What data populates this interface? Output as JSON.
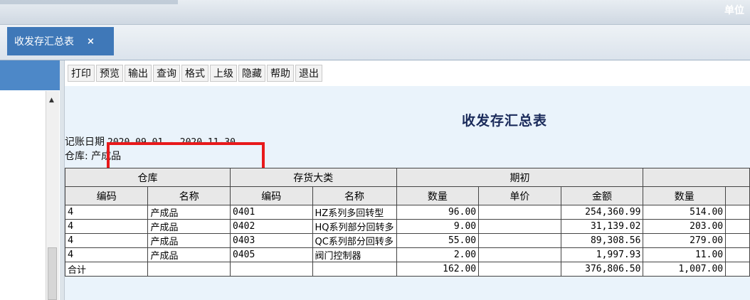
{
  "header": {
    "right_text": "单位"
  },
  "tab": {
    "label": "收发存汇总表",
    "close": "×"
  },
  "toolbar": {
    "buttons": [
      "打印",
      "预览",
      "输出",
      "查询",
      "格式",
      "上级",
      "隐藏",
      "帮助",
      "退出"
    ]
  },
  "report": {
    "title": "收发存汇总表",
    "date_label": "记账日期",
    "date_value": "2020-09-01 - 2020-11-30",
    "warehouse_label": "仓库: 产成品"
  },
  "table": {
    "group_headers": [
      "仓库",
      "存货大类",
      "期初"
    ],
    "sub_headers": [
      "编码",
      "名称",
      "编码",
      "名称",
      "数量",
      "单价",
      "金额",
      "数量"
    ],
    "rows": [
      [
        "4",
        "产成品",
        "0401",
        "HZ系列多回转型",
        "96.00",
        "",
        "254,360.99",
        "514.00"
      ],
      [
        "4",
        "产成品",
        "0402",
        "HQ系列部分回转多",
        "9.00",
        "",
        "31,139.02",
        "203.00"
      ],
      [
        "4",
        "产成品",
        "0403",
        "QC系列部分回转多",
        "55.00",
        "",
        "89,308.56",
        "279.00"
      ],
      [
        "4",
        "产成品",
        "0405",
        "阀门控制器",
        "2.00",
        "",
        "1,997.93",
        "11.00"
      ]
    ],
    "total": [
      "合计",
      "",
      "",
      "",
      "162.00",
      "",
      "376,806.50",
      "1,007.00"
    ]
  }
}
